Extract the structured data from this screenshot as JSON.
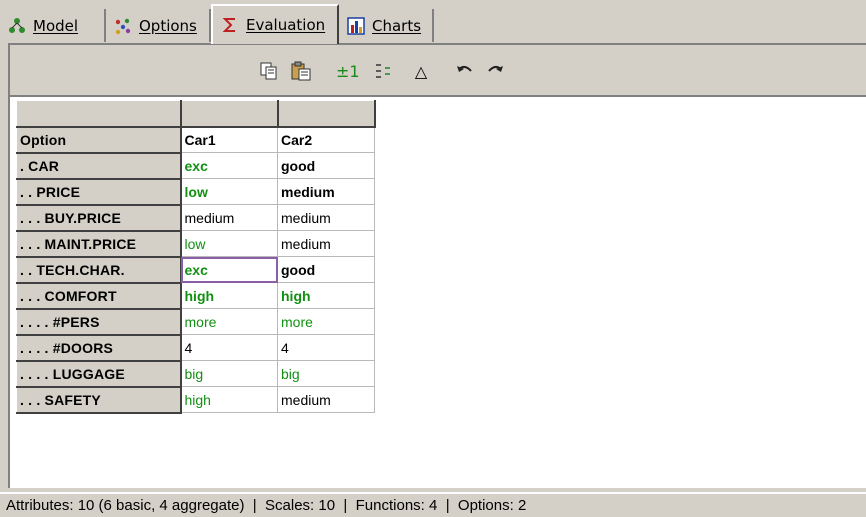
{
  "tabs": [
    {
      "label": "Model",
      "icon": "tree-icon"
    },
    {
      "label": "Options",
      "icon": "dots-icon"
    },
    {
      "label": "Evaluation",
      "icon": "sigma-icon",
      "active": true
    },
    {
      "label": "Charts",
      "icon": "bar-chart-icon"
    }
  ],
  "toolbar": {
    "copy": "copy-icon",
    "paste": "paste-icon",
    "plus_minus_label": "±1",
    "expand": "expand-icon",
    "triangle_label": "△",
    "undo": "undo-icon",
    "redo": "redo-icon"
  },
  "grid": {
    "header": {
      "option": "Option",
      "col1": "Car1",
      "col2": "Car2"
    },
    "rows": [
      {
        "label": ". CAR",
        "car1": "exc",
        "car2": "good"
      },
      {
        "label": ". . PRICE",
        "car1": "low",
        "car2": "medium"
      },
      {
        "label": ". . . BUY.PRICE",
        "car1": "medium",
        "car2": "medium"
      },
      {
        "label": ". . . MAINT.PRICE",
        "car1": "low",
        "car2": "medium"
      },
      {
        "label": ". . TECH.CHAR.",
        "car1": "exc",
        "car2": "good"
      },
      {
        "label": ". . . COMFORT",
        "car1": "high",
        "car2": "high"
      },
      {
        "label": ". . . . #PERS",
        "car1": "more",
        "car2": "more"
      },
      {
        "label": ". . . . #DOORS",
        "car1": "4",
        "car2": "4"
      },
      {
        "label": ". . . . LUGGAGE",
        "car1": "big",
        "car2": "big"
      },
      {
        "label": ". . . SAFETY",
        "car1": "high",
        "car2": "medium"
      }
    ]
  },
  "status": {
    "text": "Attributes: 10 (6 basic, 4 aggregate)  |  Scales: 10  |  Functions: 4  |  Options: 2"
  },
  "colors": {
    "good_value": "#129012",
    "background": "#d4d0c8",
    "selection": "#8a5fa8"
  }
}
